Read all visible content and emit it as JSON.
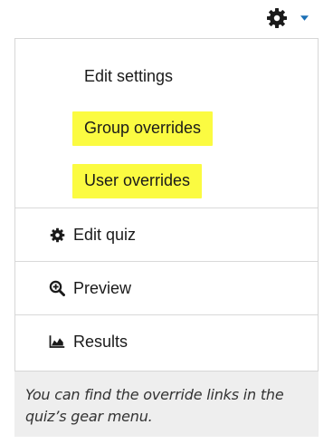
{
  "gear_menu": {
    "trigger_icon": "gear-icon",
    "caret_icon": "caret-down-icon",
    "accent_color": "#1a6fb5",
    "highlight_color": "#fbfb41",
    "items": [
      {
        "label": "Edit settings",
        "icon": null,
        "highlighted": false
      },
      {
        "label": "Group overrides",
        "icon": null,
        "highlighted": true
      },
      {
        "label": "User overrides",
        "icon": null,
        "highlighted": true
      },
      {
        "label": "Edit quiz",
        "icon": "gear-icon",
        "highlighted": false
      },
      {
        "label": "Preview",
        "icon": "zoom-in-icon",
        "highlighted": false
      },
      {
        "label": "Results",
        "icon": "area-chart-icon",
        "highlighted": false
      }
    ]
  },
  "caption": {
    "text": "You can find the override links in the quiz’s gear menu."
  }
}
